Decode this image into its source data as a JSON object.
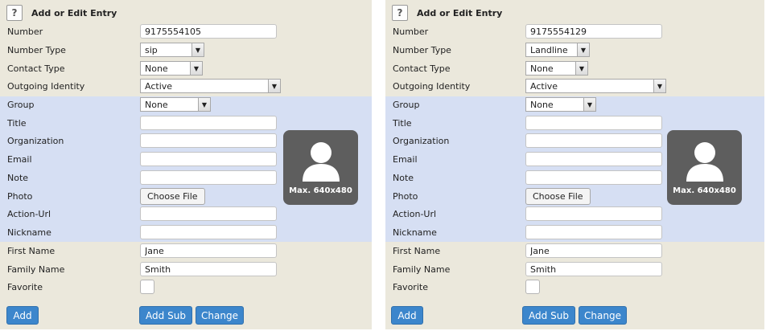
{
  "title": "Add or Edit Entry",
  "help_label": "?",
  "labels": {
    "number": "Number",
    "number_type": "Number Type",
    "contact_type": "Contact Type",
    "outgoing_identity": "Outgoing Identity",
    "group": "Group",
    "title": "Title",
    "organization": "Organization",
    "email": "Email",
    "note": "Note",
    "photo": "Photo",
    "action_url": "Action-Url",
    "nickname": "Nickname",
    "first_name": "First Name",
    "family_name": "Family Name",
    "favorite": "Favorite"
  },
  "choose_file_label": "Choose File",
  "photo_hint": "Max. 640x480",
  "buttons": {
    "add": "Add",
    "add_sub": "Add Sub",
    "change": "Change"
  },
  "panels": [
    {
      "number": "9175554105",
      "number_type": "sip",
      "contact_type": "None",
      "outgoing_identity": "Active",
      "group": "None",
      "title": "",
      "organization": "",
      "email": "",
      "note": "",
      "action_url": "",
      "nickname": "",
      "first_name": "Jane",
      "family_name": "Smith",
      "favorite": false
    },
    {
      "number": "9175554129",
      "number_type": "Landline",
      "contact_type": "None",
      "outgoing_identity": "Active",
      "group": "None",
      "title": "",
      "organization": "",
      "email": "",
      "note": "",
      "action_url": "",
      "nickname": "",
      "first_name": "Jane",
      "family_name": "Smith",
      "favorite": false
    }
  ]
}
